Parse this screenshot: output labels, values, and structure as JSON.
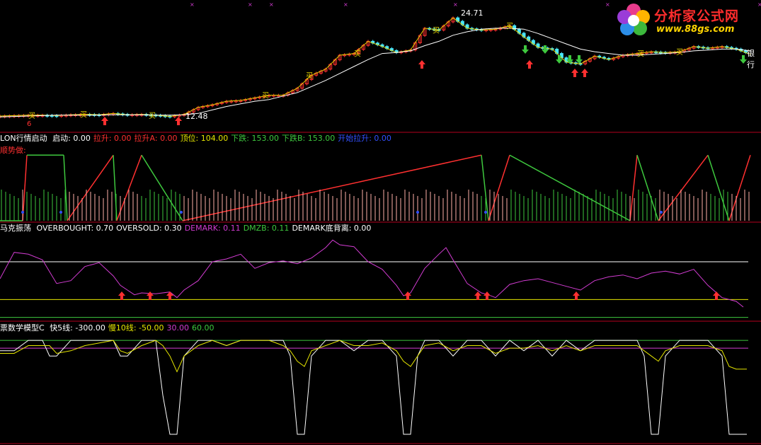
{
  "colors": {
    "bg": "#000000",
    "separator": "#b4001e",
    "price_line": "#ffffff",
    "ma_line": "#e0d000",
    "rise": "#ff3030",
    "fall": "#49e8ff",
    "green": "#3ec83e",
    "magenta": "#d23cd2",
    "yellow": "#e6e600",
    "blue": "#3350ff"
  },
  "logo": {
    "brand": "分析家公式网",
    "url": "www.88gs.com"
  },
  "pane1": {
    "high_label": "24.71",
    "low_label": "12.48",
    "right_label": "银行",
    "buy_glyph": "买",
    "top_marker": "6"
  },
  "pane2": {
    "title": "LON行情启动",
    "fields": [
      {
        "label": "启动:",
        "value": "0.00",
        "color": "#ffffff"
      },
      {
        "label": "拉升:",
        "value": "0.00",
        "color": "#ff3030"
      },
      {
        "label": "拉升A:",
        "value": "0.00",
        "color": "#ff3030"
      },
      {
        "label": "顶位:",
        "value": "104.00",
        "color": "#e6e600"
      },
      {
        "label": "下跌:",
        "value": "153.00",
        "color": "#3ec83e"
      },
      {
        "label": "下跌B:",
        "value": "153.00",
        "color": "#3ec83e"
      },
      {
        "label": "开始拉升:",
        "value": "0.00",
        "color": "#3350ff"
      }
    ],
    "subtitle": "顺势做:"
  },
  "pane3": {
    "title": "马克振荡",
    "fields": [
      {
        "label": "OVERBOUGHT:",
        "value": "0.70",
        "color": "#ffffff"
      },
      {
        "label": "OVERSOLD:",
        "value": "0.30",
        "color": "#ffffff"
      },
      {
        "label": "DEMARK:",
        "value": "0.11",
        "color": "#d23cd2"
      },
      {
        "label": "DMZB:",
        "value": "0.11",
        "color": "#3ec83e"
      },
      {
        "label": "DEMARK底背离:",
        "value": "0.00",
        "color": "#ffffff"
      }
    ]
  },
  "pane4": {
    "title": "票数学模型C",
    "fields": [
      {
        "label": "快5线:",
        "value": "-300.00",
        "color": "#ffffff"
      },
      {
        "label": "慢10线:",
        "value": "-50.00",
        "color": "#e6e600"
      },
      {
        "label": "",
        "value": "30.00",
        "color": "#d23cd2"
      },
      {
        "label": "",
        "value": "60.00",
        "color": "#3ec83e"
      }
    ]
  },
  "chart_data": [
    {
      "type": "line",
      "pane": "price",
      "x": [
        0,
        20,
        40,
        60,
        80,
        100,
        120,
        140,
        160,
        180,
        200,
        220,
        240,
        260,
        280,
        300,
        320,
        340,
        360,
        380,
        400,
        420,
        440,
        460,
        480,
        500,
        520,
        540,
        560,
        580,
        600,
        620,
        640,
        660,
        680,
        700,
        720,
        740,
        760,
        780,
        800,
        820,
        840,
        860,
        880,
        900,
        920,
        940,
        960,
        980,
        1000,
        1020,
        1040,
        1060
      ],
      "series": [
        {
          "values": [
            12.9,
            12.95,
            13.0,
            13.0,
            12.95,
            13.05,
            13.1,
            13.05,
            13.2,
            13.05,
            13.1,
            13.0,
            12.85,
            13.1,
            13.9,
            14.2,
            14.6,
            14.7,
            15.0,
            15.3,
            15.3,
            16.1,
            17.6,
            18.3,
            19.9,
            20.1,
            21.5,
            20.9,
            20.2,
            20.5,
            23.0,
            22.8,
            24.2,
            23.0,
            22.8,
            22.9,
            23.3,
            22.0,
            20.8,
            20.6,
            19.1,
            18.9,
            19.8,
            19.4,
            19.9,
            20.1,
            20.3,
            20.2,
            20.3,
            20.9,
            20.7,
            20.9,
            20.6,
            20.0
          ]
        },
        {
          "values": [
            12.8,
            12.85,
            12.9,
            12.95,
            13.0,
            13.0,
            13.0,
            13.02,
            13.05,
            13.05,
            13.05,
            13.0,
            13.0,
            13.05,
            13.2,
            13.6,
            14.0,
            14.3,
            14.6,
            14.8,
            15.2,
            15.6,
            16.3,
            17.0,
            17.8,
            18.6,
            19.4,
            20.1,
            20.2,
            20.4,
            21.0,
            21.5,
            22.2,
            22.6,
            22.9,
            23.0,
            23.0,
            22.9,
            22.4,
            21.8,
            21.2,
            20.6,
            20.3,
            20.1,
            19.9,
            19.9,
            20.0,
            20.1,
            20.2,
            20.4,
            20.5,
            20.6,
            20.6,
            20.4
          ]
        }
      ],
      "annotations": [
        "24.71",
        "12.48"
      ],
      "ylim": [
        11.6,
        25.6
      ]
    },
    {
      "type": "line",
      "pane": "LON行情启动",
      "x": [
        0,
        32,
        38,
        90,
        95,
        160,
        165,
        200,
        258,
        680,
        690,
        720,
        890,
        900,
        930,
        1000,
        1030,
        1060
      ],
      "series": [
        {
          "values": [
            0,
            0,
            104,
            104,
            0,
            104,
            0,
            104,
            0,
            104,
            0,
            104,
            0,
            104,
            0,
            104,
            0,
            104
          ]
        }
      ],
      "ylim": [
        0,
        120
      ]
    },
    {
      "type": "line",
      "pane": "马克振荡",
      "x": [
        0,
        20,
        40,
        60,
        80,
        100,
        120,
        140,
        160,
        170,
        180,
        190,
        200,
        220,
        240,
        250,
        260,
        280,
        300,
        320,
        340,
        360,
        380,
        400,
        420,
        440,
        460,
        470,
        480,
        500,
        520,
        540,
        560,
        570,
        580,
        600,
        620,
        630,
        640,
        660,
        680,
        690,
        700,
        720,
        740,
        760,
        780,
        800,
        820,
        840,
        860,
        880,
        900,
        920,
        940,
        960,
        980,
        1000,
        1020,
        1040,
        1050
      ],
      "series": [
        {
          "name": "DEMARK",
          "values": [
            0.52,
            0.8,
            0.78,
            0.72,
            0.47,
            0.5,
            0.65,
            0.69,
            0.55,
            0.45,
            0.4,
            0.35,
            0.37,
            0.36,
            0.38,
            0.32,
            0.4,
            0.5,
            0.7,
            0.73,
            0.78,
            0.63,
            0.69,
            0.71,
            0.68,
            0.74,
            0.85,
            0.93,
            0.88,
            0.86,
            0.7,
            0.62,
            0.45,
            0.34,
            0.37,
            0.63,
            0.78,
            0.85,
            0.72,
            0.47,
            0.37,
            0.35,
            0.32,
            0.46,
            0.5,
            0.52,
            0.48,
            0.44,
            0.4,
            0.5,
            0.54,
            0.56,
            0.52,
            0.58,
            0.6,
            0.57,
            0.62,
            0.45,
            0.32,
            0.28,
            0.22
          ]
        }
      ],
      "ylim": [
        0.1,
        1.0
      ]
    },
    {
      "type": "line",
      "pane": "数学模型C",
      "x": [
        0,
        20,
        40,
        60,
        70,
        80,
        100,
        120,
        160,
        170,
        180,
        200,
        220,
        230,
        240,
        250,
        260,
        280,
        300,
        320,
        340,
        380,
        400,
        410,
        420,
        430,
        440,
        460,
        480,
        500,
        520,
        540,
        560,
        570,
        580,
        590,
        600,
        620,
        640,
        660,
        680,
        700,
        720,
        740,
        760,
        780,
        800,
        820,
        840,
        860,
        880,
        900,
        910,
        920,
        930,
        940,
        960,
        980,
        1000,
        1020,
        1030,
        1040,
        1055
      ],
      "series": [
        {
          "name": "快5线",
          "values": [
            20,
            20,
            60,
            60,
            0,
            0,
            60,
            60,
            60,
            0,
            0,
            60,
            60,
            -150,
            -300,
            -300,
            0,
            60,
            60,
            40,
            60,
            60,
            60,
            0,
            -300,
            -300,
            0,
            60,
            60,
            20,
            60,
            60,
            0,
            -300,
            -300,
            0,
            60,
            60,
            0,
            60,
            60,
            0,
            60,
            20,
            60,
            0,
            60,
            20,
            60,
            60,
            60,
            60,
            0,
            -300,
            -300,
            0,
            60,
            60,
            60,
            0,
            -300,
            -300,
            -300
          ]
        },
        {
          "name": "慢10线",
          "values": [
            10,
            10,
            40,
            40,
            40,
            10,
            20,
            40,
            60,
            20,
            10,
            40,
            60,
            40,
            0,
            -60,
            0,
            40,
            60,
            40,
            60,
            60,
            40,
            20,
            -20,
            -40,
            20,
            40,
            60,
            40,
            40,
            50,
            20,
            -20,
            -40,
            0,
            40,
            50,
            20,
            40,
            40,
            10,
            30,
            30,
            40,
            20,
            40,
            20,
            40,
            40,
            40,
            40,
            20,
            0,
            -20,
            20,
            40,
            40,
            40,
            20,
            -40,
            -50,
            -50
          ]
        }
      ],
      "ylim": [
        -330,
        90
      ]
    }
  ]
}
